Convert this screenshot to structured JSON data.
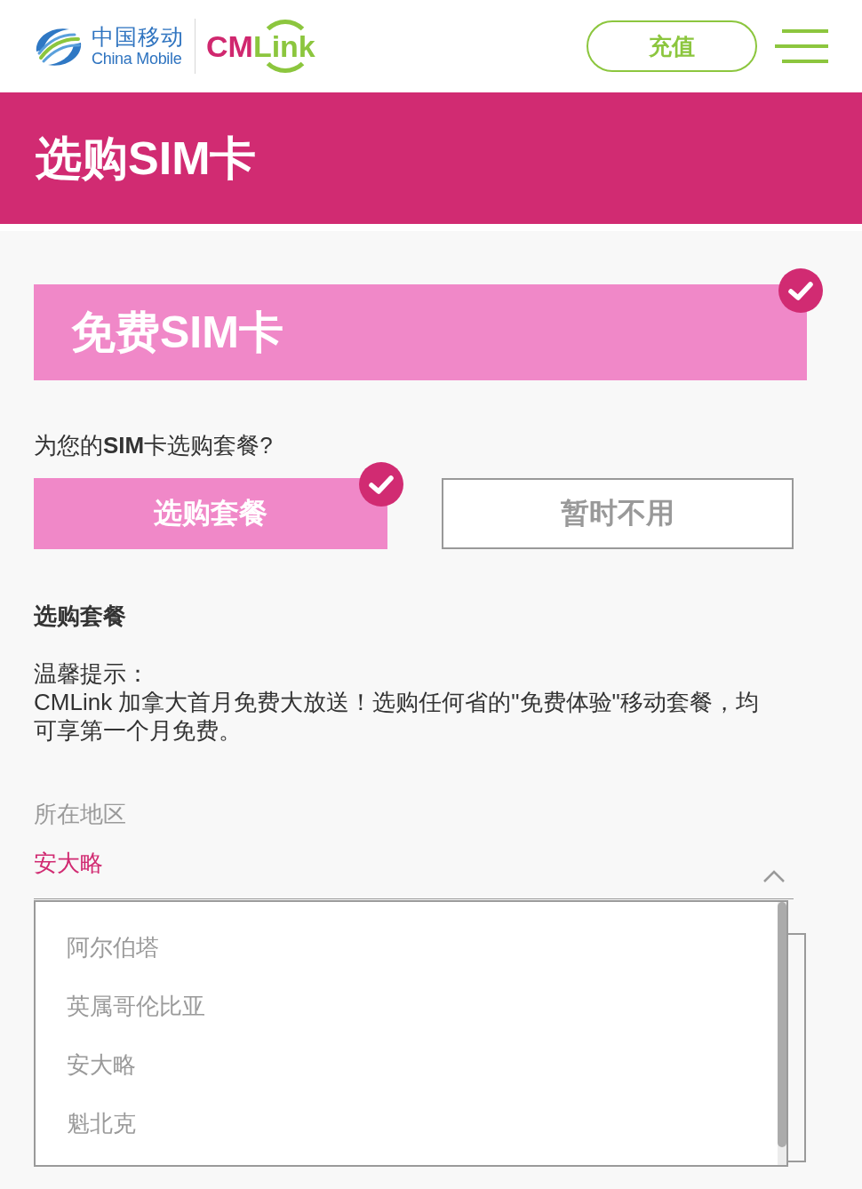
{
  "header": {
    "brand": {
      "name": "中国移动",
      "subtitle": "China Mobile"
    },
    "wordmark": {
      "part_1": "CM",
      "part_2": "Link"
    },
    "recharge_button": "充值"
  },
  "page_title": "选购SIM卡",
  "sim_card": {
    "title": "免费SIM卡",
    "selected": true
  },
  "plan_question": "为您的**SIM**卡选购套餐?",
  "plan_options": [
    {
      "label": "选购套餐",
      "selected": true
    },
    {
      "label": "暂时不用",
      "selected": false
    }
  ],
  "section_heading": "选购套餐",
  "tip": {
    "label": "温馨提示：",
    "text": "CMLink 加拿大首月免费大放送！选购任何省的\"免费体验\"移动套餐，均可享第一个月免费。"
  },
  "region": {
    "label": "所在地区",
    "value": "安大略",
    "expanded": true,
    "options": [
      "阿尔伯塔",
      "英属哥伦比亚",
      "安大略",
      "魁北克"
    ]
  }
}
